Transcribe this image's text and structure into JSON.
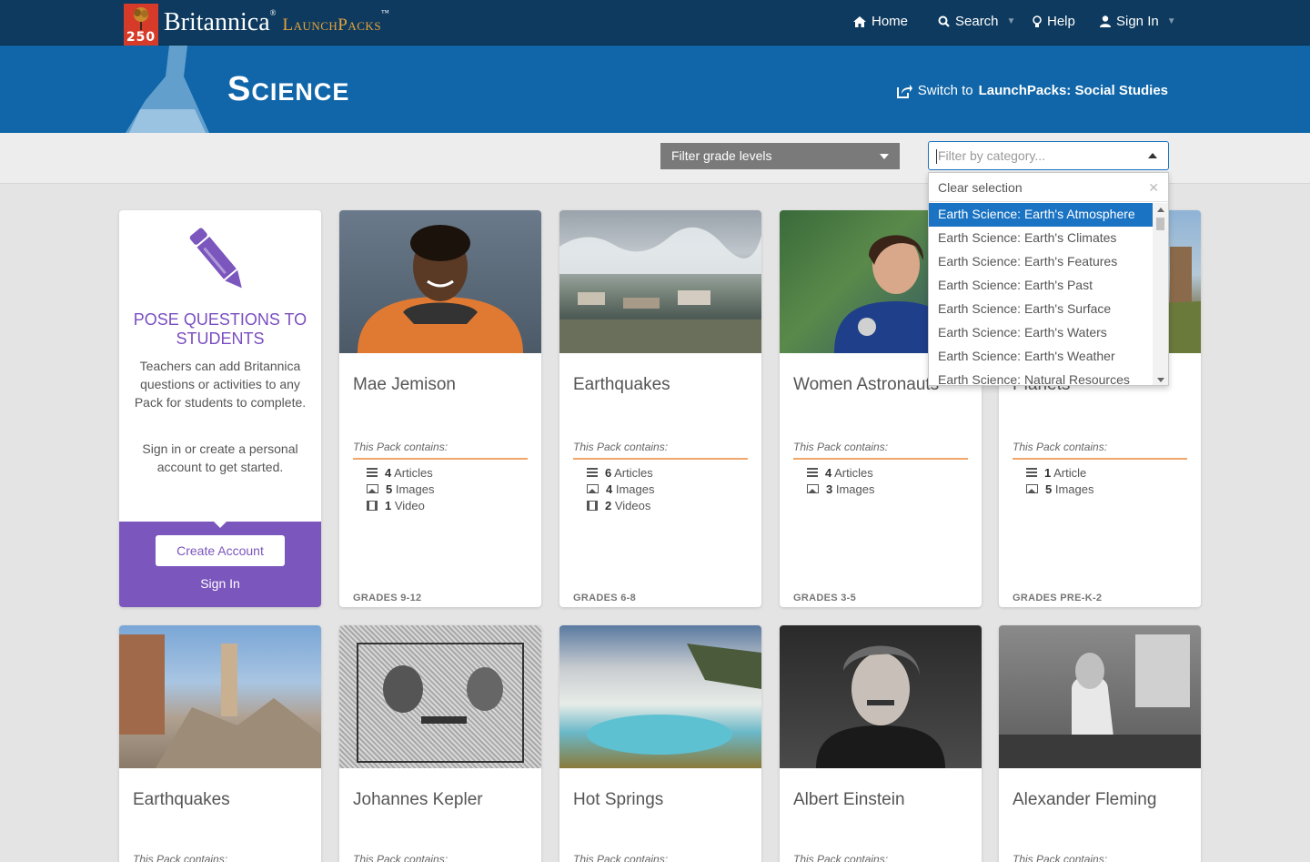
{
  "header": {
    "logo_number": "250",
    "brand_name": "Britannica",
    "brand_sub": "LaunchPacks",
    "nav": {
      "home": "Home",
      "search": "Search",
      "help": "Help",
      "signin": "Sign In"
    }
  },
  "banner": {
    "title": "Science",
    "switch_prefix": "Switch to ",
    "switch_target": "LaunchPacks: Social Studies"
  },
  "filters": {
    "grade_label": "Filter grade levels",
    "category_placeholder": "Filter by category...",
    "dropdown": {
      "clear_label": "Clear selection",
      "items": [
        "Earth Science: Earth's Atmosphere",
        "Earth Science: Earth's Climates",
        "Earth Science: Earth's Features",
        "Earth Science: Earth's Past",
        "Earth Science: Earth's Surface",
        "Earth Science: Earth's Waters",
        "Earth Science: Earth's Weather",
        "Earth Science: Natural Resources"
      ],
      "selected_index": 0
    }
  },
  "promo": {
    "title": "POSE QUESTIONS TO STUDENTS",
    "text1": "Teachers can add Britannica questions or activities to any Pack for students to complete.",
    "text2": "Sign in or create a personal account to get started.",
    "create_label": "Create Account",
    "signin_label": "Sign In"
  },
  "packs": [
    {
      "title": "Mae Jemison",
      "contains_label": "This Pack contains:",
      "articles_n": "4",
      "articles_label": "Articles",
      "images_n": "5",
      "images_label": "Images",
      "videos_n": "1",
      "videos_label": "Video",
      "grades": "GRADES 9-12"
    },
    {
      "title": "Earthquakes",
      "contains_label": "This Pack contains:",
      "articles_n": "6",
      "articles_label": "Articles",
      "images_n": "4",
      "images_label": "Images",
      "videos_n": "2",
      "videos_label": "Videos",
      "grades": "GRADES 6-8"
    },
    {
      "title": "Women Astronauts",
      "contains_label": "This Pack contains:",
      "articles_n": "4",
      "articles_label": "Articles",
      "images_n": "3",
      "images_label": "Images",
      "grades": "GRADES 3-5"
    },
    {
      "title": "Planets",
      "contains_label": "This Pack contains:",
      "articles_n": "1",
      "articles_label": "Article",
      "images_n": "5",
      "images_label": "Images",
      "grades": "GRADES PRE-K-2"
    },
    {
      "title": "Earthquakes",
      "contains_label": "This Pack contains:"
    },
    {
      "title": "Johannes Kepler",
      "contains_label": "This Pack contains:"
    },
    {
      "title": "Hot Springs",
      "contains_label": "This Pack contains:"
    },
    {
      "title": "Albert Einstein",
      "contains_label": "This Pack contains:"
    },
    {
      "title": "Alexander Fleming",
      "contains_label": "This Pack contains:"
    }
  ],
  "colors": {
    "topbar": "#0d3a5e",
    "banner": "#1066a9",
    "accent_purple": "#7b56bd",
    "dropdown_active": "#1a73c3",
    "divider_orange": "#f0a66a"
  }
}
